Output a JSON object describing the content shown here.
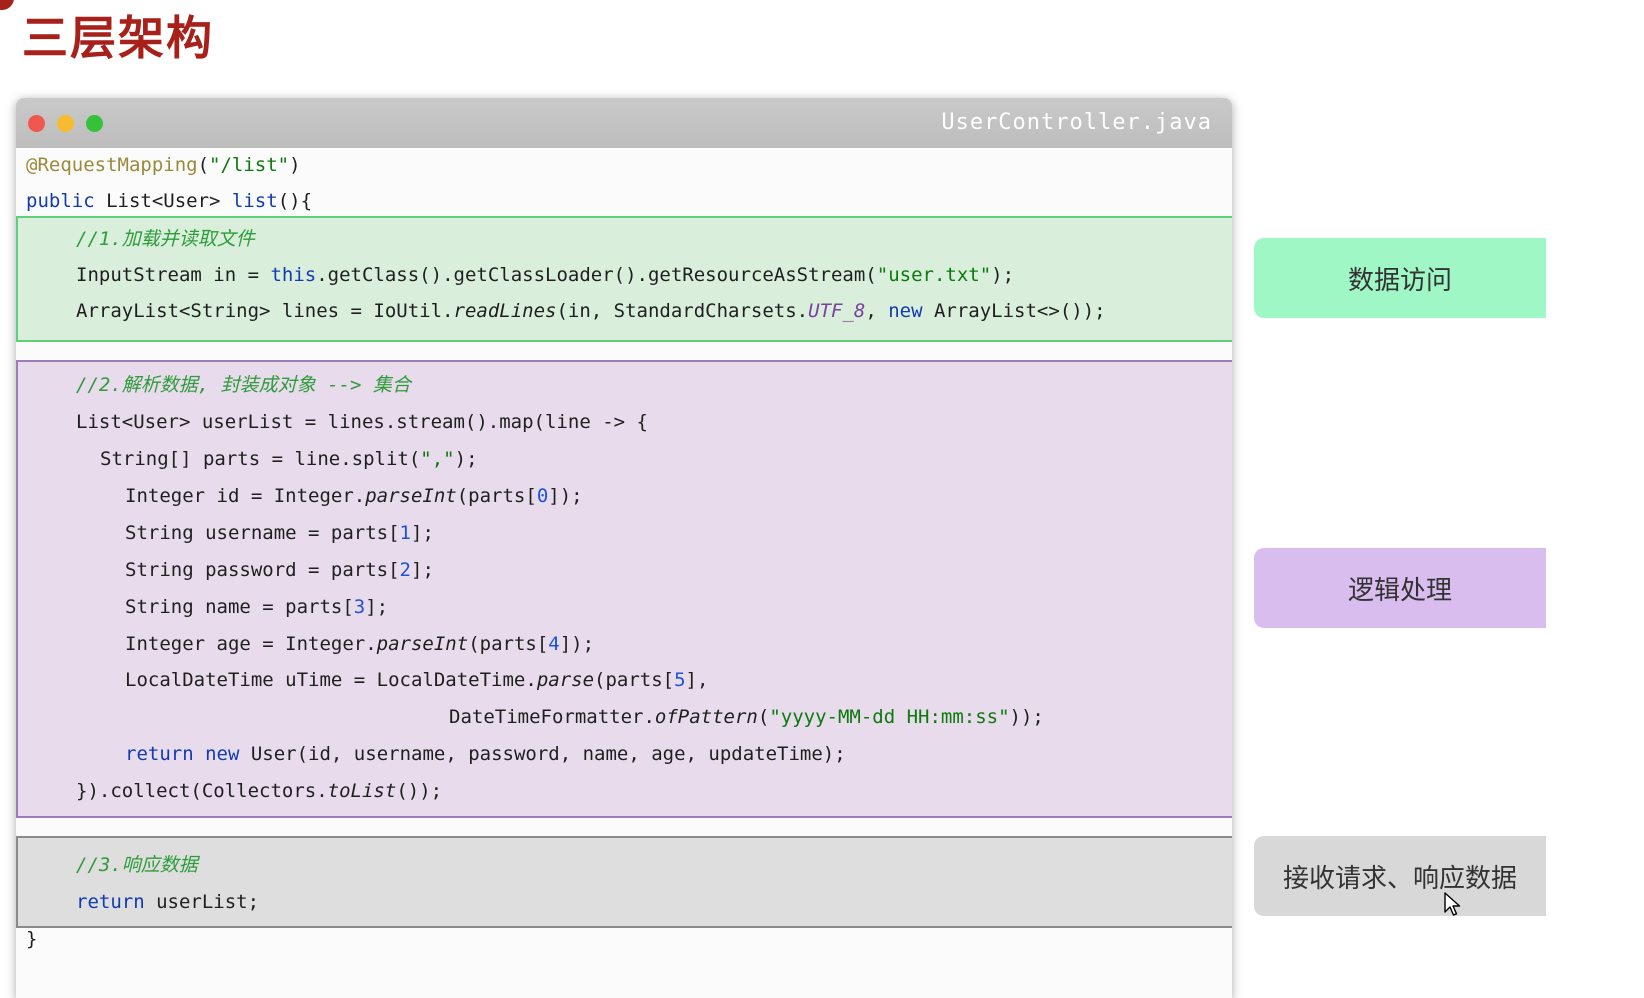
{
  "page": {
    "title": "三层架构"
  },
  "window": {
    "filename": "UserController.java",
    "code": {
      "line1": {
        "ann": "@RequestMapping",
        "p1": "(",
        "str": "\"/list\"",
        "p2": ")"
      },
      "line2": {
        "kw": "public",
        "t1": " List<User> ",
        "m": "list",
        "t2": "(){"
      },
      "green": {
        "comment": "//1.加载并读取文件",
        "l1": {
          "t1": "InputStream in = ",
          "kw": "this",
          "t2": ".getClass().getClassLoader().getResourceAsStream(",
          "str": "\"user.txt\"",
          "t3": ");"
        },
        "l2": {
          "t1": "ArrayList<String> lines = IoUtil.",
          "it": "readLines",
          "t2": "(in, StandardCharsets.",
          "purp": "UTF_8",
          "t3": ", ",
          "kw": "new",
          "t4": " ArrayList<>());"
        }
      },
      "purple": {
        "comment": "//2.解析数据, 封装成对象 --> 集合",
        "l1": "List<User> userList = lines.stream().map(line -> {",
        "l2": {
          "t1": "String[] parts = line.split(",
          "str": "\",\"",
          "t2": ");"
        },
        "l3": {
          "t1": "Integer id = Integer.",
          "it": "parseInt",
          "t2": "(parts[",
          "n": "0",
          "t3": "]);"
        },
        "l4": {
          "t1": "String username = parts[",
          "n": "1",
          "t2": "];"
        },
        "l5": {
          "t1": "String password = parts[",
          "n": "2",
          "t2": "];"
        },
        "l6": {
          "t1": "String name = parts[",
          "n": "3",
          "t2": "];"
        },
        "l7": {
          "t1": "Integer age = Integer.",
          "it": "parseInt",
          "t2": "(parts[",
          "n": "4",
          "t3": "]);"
        },
        "l8": {
          "t1": "LocalDateTime uTime = LocalDateTime.",
          "it": "parse",
          "t2": "(parts[",
          "n": "5",
          "t3": "],"
        },
        "l9": {
          "t1": "DateTimeFormatter.",
          "it": "ofPattern",
          "t2": "(",
          "str": "\"yyyy-MM-dd HH:mm:ss\"",
          "t3": "));"
        },
        "l10": {
          "kw1": "return",
          "sp": " ",
          "kw2": "new",
          "t1": " User(id, username, password, name, age, updateTime);"
        },
        "l11": {
          "t1": "}).collect(Collectors.",
          "it": "toList",
          "t2": "());"
        }
      },
      "gray": {
        "comment": "//3.响应数据",
        "l1": {
          "kw": "return",
          "t1": " userList;"
        }
      },
      "closing": "}"
    }
  },
  "side_buttons": {
    "data_access": "数据访问",
    "logic": "逻辑处理",
    "response": "接收请求、响应数据"
  },
  "colors": {
    "title": "#a8201a",
    "data_access_bg": "#9ff7c6",
    "logic_bg": "#d8bdee",
    "response_bg": "#d8d8d8"
  }
}
